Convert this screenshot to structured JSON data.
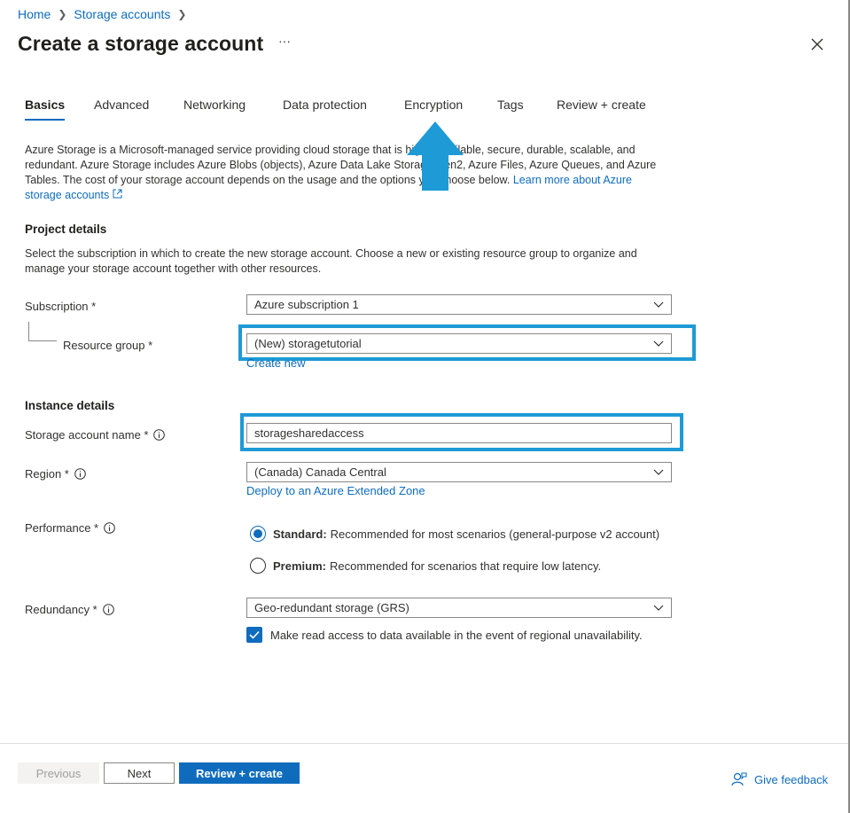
{
  "breadcrumb": {
    "items": [
      "Home",
      "Storage accounts"
    ],
    "separator": ">"
  },
  "header": {
    "title": "Create a storage account",
    "more": "···"
  },
  "tabs": [
    {
      "label": "Basics",
      "active": true
    },
    {
      "label": "Advanced"
    },
    {
      "label": "Networking"
    },
    {
      "label": "Data protection"
    },
    {
      "label": "Encryption"
    },
    {
      "label": "Tags"
    },
    {
      "label": "Review + create"
    }
  ],
  "intro": {
    "line1": "Azure Storage is a Microsoft-managed service providing cloud storage that is highly available, secure, durable, scalable, and",
    "line2": "redundant. Azure Storage includes Azure Blobs (objects), Azure Data Lake Storage Gen2, Azure Files, Azure Queues, and Azure",
    "line3": "Tables. The cost of your storage account depends on the usage and the options you choose below.",
    "link": "Learn more about Azure storage accounts"
  },
  "project": {
    "title": "Project details",
    "description": "Select the subscription in which to create the new storage account. Choose a new or existing resource group to organize and manage your storage account together with other resources.",
    "subscription_label": "Subscription *",
    "subscription_value": "Azure subscription 1",
    "resource_group_label": "Resource group *",
    "resource_group_value": "(New) storagetutorial",
    "create_new": "Create new"
  },
  "instance": {
    "title": "Instance details",
    "name_label": "Storage account name *",
    "name_value": "storagesharedaccess",
    "region_label": "Region *",
    "region_value": "(Canada) Canada Central",
    "extended_zone_link": "Deploy to an Azure Extended Zone",
    "performance_label": "Performance *",
    "standard_title": "Standard:",
    "standard_desc": "Recommended for most scenarios (general-purpose v2 account)",
    "premium_title": "Premium:",
    "premium_desc": "Recommended for scenarios that require low latency.",
    "redundancy_label": "Redundancy *",
    "redundancy_value": "Geo-redundant storage (GRS)",
    "read_access_label": "Make read access to data available in the event of regional unavailability."
  },
  "footer": {
    "previous": "Previous",
    "next": "Next",
    "review": "Review + create",
    "feedback": "Give feedback"
  },
  "colors": {
    "accent": "#0f6cbd",
    "highlight": "#1e9ad6"
  }
}
